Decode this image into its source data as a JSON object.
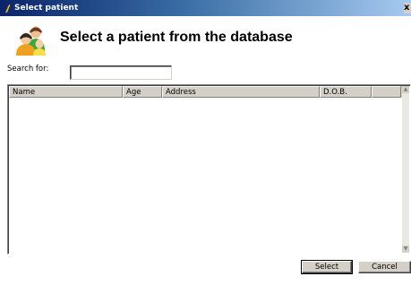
{
  "window": {
    "title": "Select patient",
    "close_glyph": "x"
  },
  "header": {
    "title": "Select a patient from the database",
    "icon": "patients-group-icon"
  },
  "search": {
    "label": "Search for:",
    "value": "",
    "placeholder": ""
  },
  "table": {
    "columns": [
      "Name",
      "Age",
      "Address",
      "D.O.B.",
      ""
    ],
    "rows": []
  },
  "buttons": {
    "select": "Select",
    "cancel": "Cancel"
  }
}
